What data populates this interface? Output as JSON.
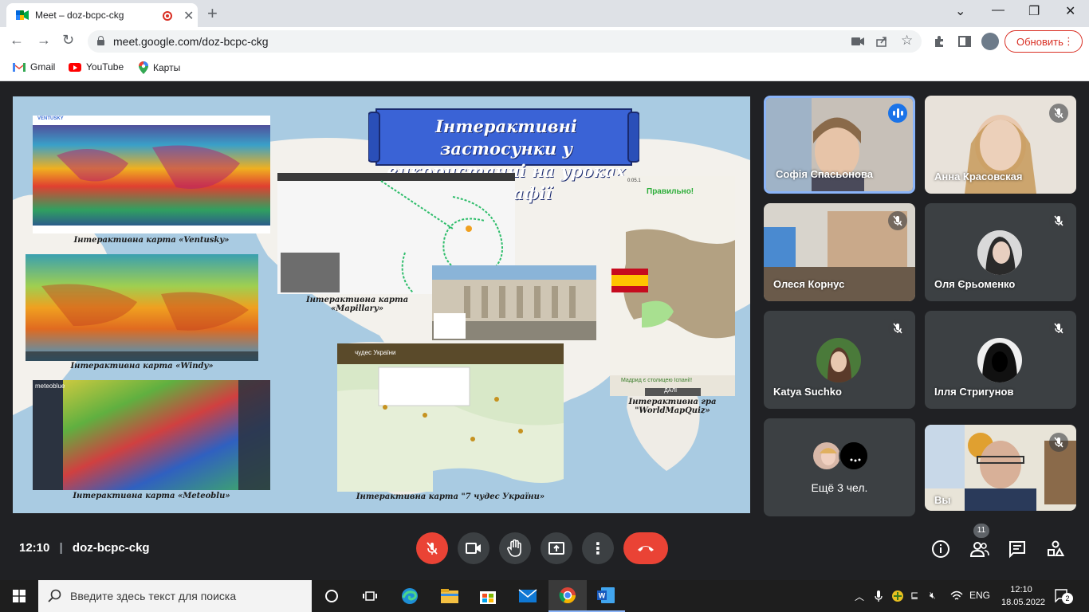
{
  "browser": {
    "tab_title": "Meet – doz-bcpc-ckg",
    "url": "meet.google.com/doz-bcpc-ckg",
    "update_button": "Обновить",
    "bookmarks": [
      {
        "label": "Gmail",
        "icon": "gmail-icon"
      },
      {
        "label": "YouTube",
        "icon": "youtube-icon"
      },
      {
        "label": "Карты",
        "icon": "maps-icon"
      }
    ]
  },
  "slide": {
    "title_line1": "Інтерактивні застосунки у",
    "title_line2": "використанні на уроках географії",
    "captions": {
      "ventusky": "Інтерактивна карта «Ventusky»",
      "windy": "Інтерактивна карта «Windy»",
      "meteoblue": "Інтерактивна карта «Meteoblu»",
      "mapillary_1": "Інтерактивна карта",
      "mapillary_2": "«Mapillary»",
      "seven_wonders": "Інтерактивна карта \"7 чудес України»",
      "wmq_1": "Інтерактивна гра",
      "wmq_2": "\"WorldMapQuiz»"
    },
    "quiz": {
      "correct": "Правильно!",
      "answer": "Мадрид є столицею Іспанії!",
      "next": "ДАЛІ",
      "timer": "0:05.1"
    },
    "seven_wonders_header": "чудес України",
    "meteoblue_logo": "meteoblue",
    "ventusky_logo": "VENTUSKY"
  },
  "participants": [
    {
      "name": "Софія Спасьонова",
      "speaking": true
    },
    {
      "name": "Анна Красовская",
      "muted": true
    },
    {
      "name": "Олеся Корнус",
      "muted": true
    },
    {
      "name": "Оля Єрьоменко",
      "muted": true
    },
    {
      "name": "Katya Suchko",
      "muted": true
    },
    {
      "name": "Ілля Стригунов",
      "muted": true
    },
    {
      "name": "Ещё 3 чел."
    },
    {
      "name": "Вы",
      "muted": true
    }
  ],
  "meeting": {
    "time": "12:10",
    "code": "doz-bcpc-ckg",
    "people_count": "11"
  },
  "taskbar": {
    "search_placeholder": "Введите здесь текст для поиска",
    "lang": "ENG",
    "time": "12:10",
    "date": "18.05.2022",
    "notifications": "2"
  },
  "colors": {
    "meet_bg": "#202124",
    "tile_bg": "#3c4043",
    "end_call": "#ea4335",
    "accent_blue": "#8ab4f8",
    "update_red": "#d93025"
  }
}
